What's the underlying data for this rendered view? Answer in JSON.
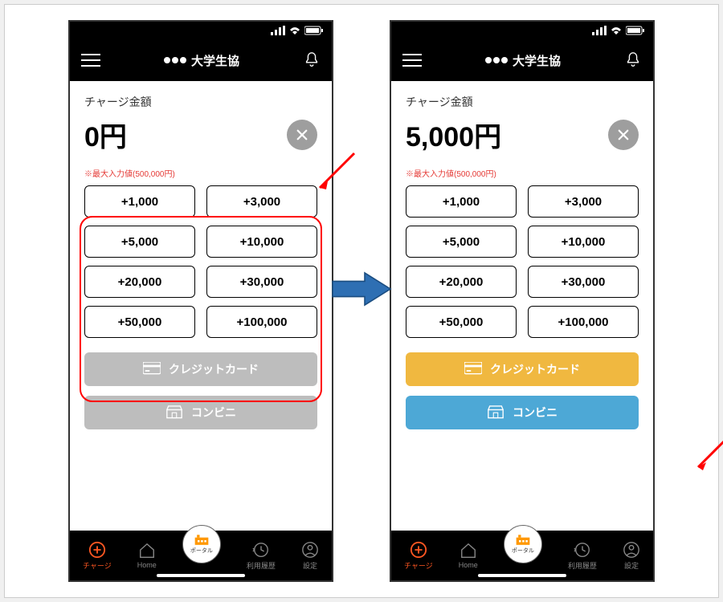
{
  "status": {
    "signal": "signal",
    "wifi": "wifi",
    "battery": "battery"
  },
  "header": {
    "title": "大学生協"
  },
  "left": {
    "charge_label": "チャージ金額",
    "amount": "0円",
    "max_note": "※最大入力値(500,000円)",
    "pay_credit": "クレジットカード",
    "pay_conv": "コンビニ"
  },
  "right": {
    "charge_label": "チャージ金額",
    "amount": "5,000円",
    "max_note": "※最大入力値(500,000円)",
    "pay_credit": "クレジットカード",
    "pay_conv": "コンビニ"
  },
  "amount_buttons": [
    "+1,000",
    "+3,000",
    "+5,000",
    "+10,000",
    "+20,000",
    "+30,000",
    "+50,000",
    "+100,000"
  ],
  "nav": {
    "charge": "チャージ",
    "home": "Home",
    "portal": "ポータル",
    "history": "利用履歴",
    "settings": "設定"
  }
}
